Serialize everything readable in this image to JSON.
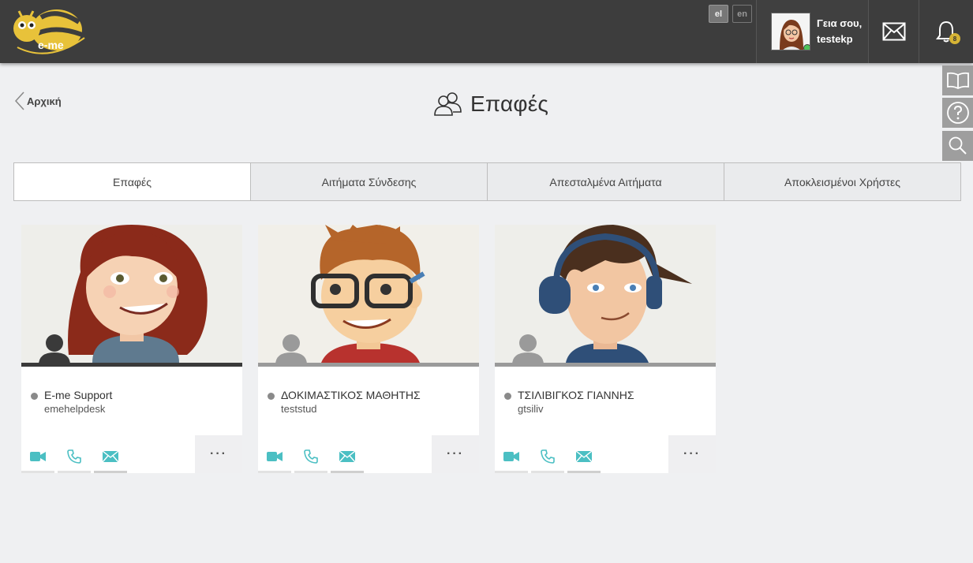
{
  "header": {
    "logo_text": "e-me",
    "languages": [
      {
        "code": "el",
        "active": true
      },
      {
        "code": "en",
        "active": false
      }
    ],
    "greeting_line1": "Γεια σου,",
    "greeting_line2": "testekp",
    "notification_count": "8"
  },
  "side_tools": [
    "book-icon",
    "help-icon",
    "search-icon"
  ],
  "page": {
    "back_label": "Αρχική",
    "title": "Επαφές"
  },
  "tabs": [
    {
      "label": "Επαφές",
      "active": true
    },
    {
      "label": "Αιτήματα Σύνδεσης",
      "active": false
    },
    {
      "label": "Απεσταλμένα Αιτήματα",
      "active": false
    },
    {
      "label": "Αποκλεισμένοι Χρήστες",
      "active": false
    }
  ],
  "contacts": [
    {
      "name": "E-me Support",
      "username": "emehelpdesk"
    },
    {
      "name": "ΔΟΚΙΜΑΣΤΙΚΟΣ ΜΑΘΗΤΗΣ",
      "username": "teststud"
    },
    {
      "name": "ΤΣΙΛΙΒΙΓΚΟΣ ΓΙΑΝΝΗΣ",
      "username": "gtsiliv"
    }
  ],
  "card_actions": {
    "more_label": "···"
  },
  "colors": {
    "header_bg": "#3d3d3d",
    "accent_teal": "#4bbfc3",
    "badge": "#d6b435",
    "online": "#4dc35a"
  }
}
